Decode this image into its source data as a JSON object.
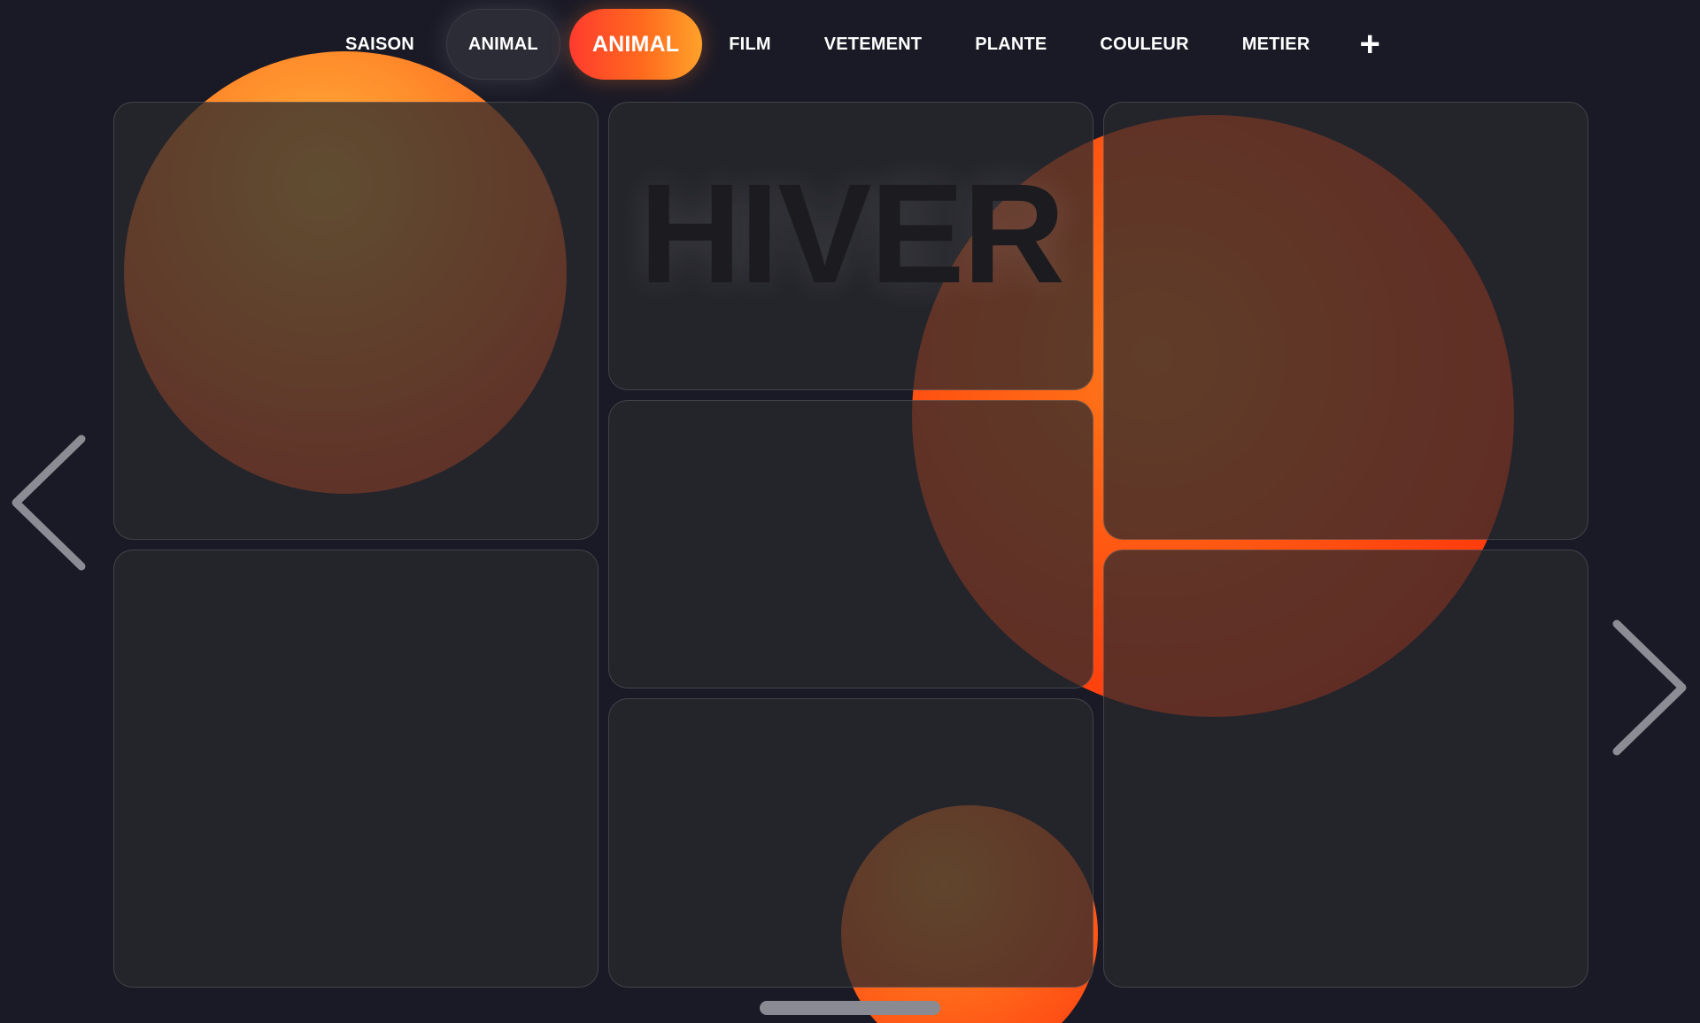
{
  "nav": {
    "items": [
      {
        "label": "SAISON"
      },
      {
        "label": "ANIMAL"
      },
      {
        "label": "ANIMAL"
      },
      {
        "label": "FILM"
      },
      {
        "label": "VETEMENT"
      },
      {
        "label": "PLANTE"
      },
      {
        "label": "COULEUR"
      },
      {
        "label": "METIER"
      }
    ],
    "add_label": "+"
  },
  "cards": {
    "featured_word": "HIVER"
  },
  "colors": {
    "background": "#1a1a26",
    "accent_start": "#ff3b2e",
    "accent_end": "#ffa22a",
    "orb": "#ff6a1a"
  },
  "icons": {
    "prev": "chevron-left-icon",
    "next": "chevron-right-icon",
    "add": "plus-icon"
  }
}
